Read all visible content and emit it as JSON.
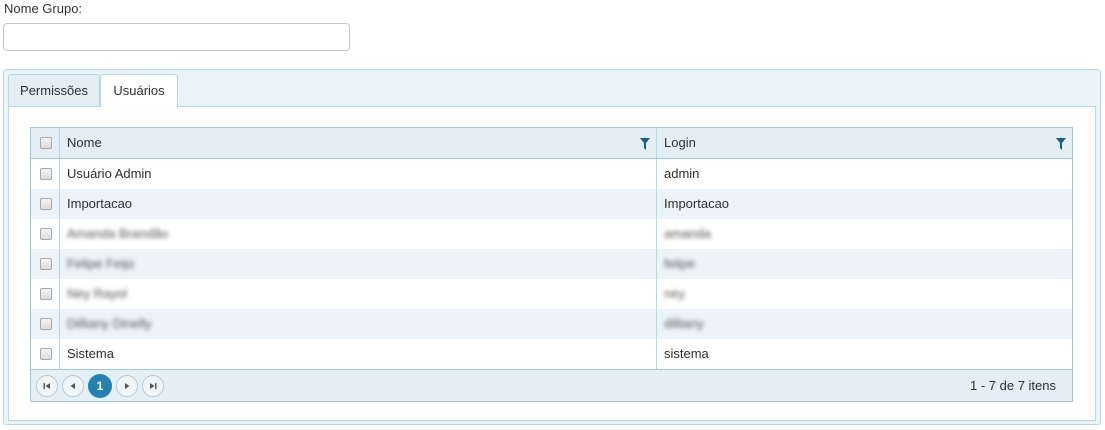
{
  "form": {
    "group_name_label": "Nome Grupo:",
    "group_name_value": ""
  },
  "tabs": [
    {
      "label": "Permissões",
      "active": false
    },
    {
      "label": "Usuários",
      "active": true
    }
  ],
  "grid": {
    "columns": [
      "Nome",
      "Login"
    ],
    "rows": [
      {
        "nome": "Usuário Admin",
        "login": "admin"
      },
      {
        "nome": "Importacao",
        "login": "Importacao"
      },
      {
        "nome": "Amanda Brandão",
        "login": "amanda"
      },
      {
        "nome": "Felipe Feijo",
        "login": "felipe"
      },
      {
        "nome": "Ney Rayol",
        "login": "ney"
      },
      {
        "nome": "Dilliany Dinelly",
        "login": "dilliany"
      },
      {
        "nome": "Sistema",
        "login": "sistema"
      }
    ],
    "pager": {
      "current_page": "1",
      "info": "1 - 7 de 7 itens"
    }
  },
  "colors": {
    "accent": "#2582b0",
    "header_bg": "#e3eff5",
    "border": "#9ec7dc",
    "alt_row": "#ecf4fa"
  }
}
